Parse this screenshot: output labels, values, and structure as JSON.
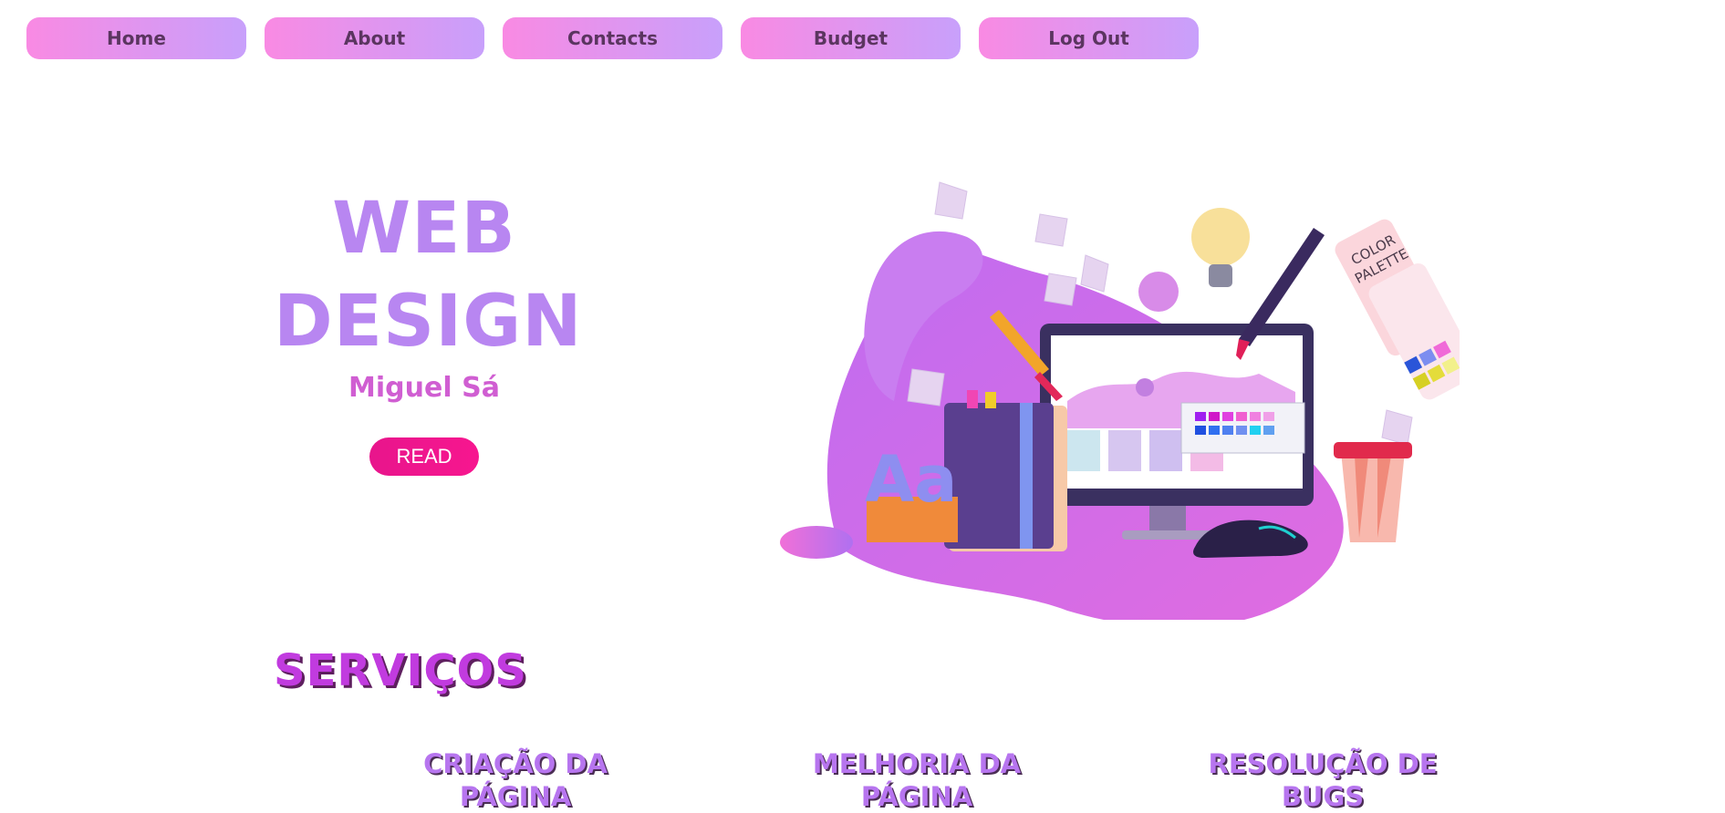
{
  "nav": {
    "items": [
      {
        "label": "Home"
      },
      {
        "label": "About"
      },
      {
        "label": "Contacts"
      },
      {
        "label": "Budget"
      },
      {
        "label": "Log Out"
      }
    ]
  },
  "hero": {
    "title_line1": "WEB",
    "title_line2": "DESIGN",
    "author": "Miguel Sá",
    "read_label": "READ"
  },
  "illustration": {
    "palette_line1": "COLOR",
    "palette_line2": "PALETTE",
    "letters": "Aa"
  },
  "services": {
    "title": "SERVIÇOS",
    "items": [
      {
        "line1": "CRIAÇÃO DA PÁGINA",
        "line2": ""
      },
      {
        "line1": "MELHORIA DA",
        "line2": "PÁGINA"
      },
      {
        "line1": "RESOLUÇÃO DE",
        "line2": "BUGS"
      }
    ]
  },
  "colors": {
    "nav_gradient_start": "#f98ae3",
    "nav_gradient_end": "#c8a0fb",
    "hero_title": "#b886f1",
    "author": "#d05ed2",
    "read_button": "#e8158c",
    "services_title": "#c13bdf",
    "service_item": "#b775ef"
  }
}
